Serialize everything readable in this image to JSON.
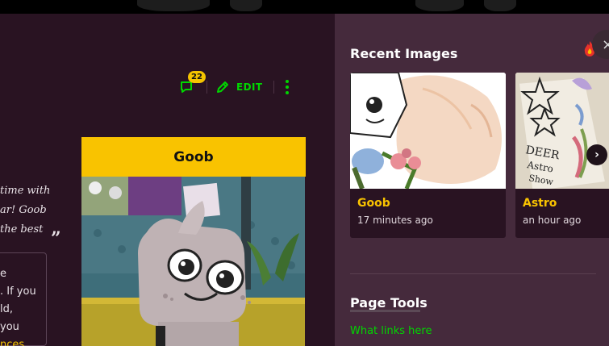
{
  "article": {
    "comment_count": "22",
    "edit_label": "EDIT",
    "quote_lines": [
      "time with",
      "ar! Goob",
      "the best"
    ],
    "quote_mark": "”",
    "tip_lines": [
      "e",
      ". If you",
      "ld,",
      "you"
    ],
    "tip_link": "nces"
  },
  "infobox": {
    "title": "Goob"
  },
  "rail": {
    "recent_heading": "Recent Images",
    "close_icon": "×",
    "next_icon": "›",
    "cards": [
      {
        "title": "Goob",
        "time": "17 minutes ago"
      },
      {
        "title": "Astro",
        "time": "an hour ago"
      }
    ],
    "tools_heading": "Page Tools",
    "tools_link": "What links here"
  },
  "colors": {
    "accent_green": "#00d600",
    "accent_yellow": "#f9c300",
    "main_bg": "#291322",
    "rail_bg": "#452a3c"
  }
}
